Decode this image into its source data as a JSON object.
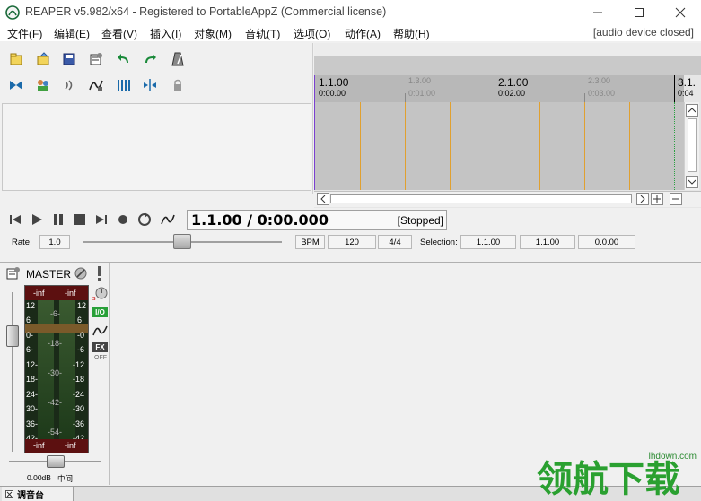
{
  "window": {
    "title": "REAPER v5.982/x64 - Registered to PortableAppZ (Commercial license)"
  },
  "menu": {
    "items": [
      "文件(F)",
      "编辑(E)",
      "查看(V)",
      "插入(I)",
      "对象(M)",
      "音轨(T)",
      "选项(O)",
      "动作(A)",
      "帮助(H)"
    ],
    "status": "[audio device closed]"
  },
  "toolbar": {
    "icons": [
      "new-project-icon",
      "open-project-icon",
      "save-project-icon",
      "project-settings-icon",
      "undo-icon",
      "redo-icon",
      "metronome-icon",
      "ripple-edit-icon",
      "grouping-icon",
      "auto-crossfade-icon",
      "envelope-icon",
      "snap-grid-icon",
      "split-icon",
      "lock-icon"
    ]
  },
  "timeline": {
    "bars": [
      {
        "label": "1.1.00",
        "time": "0:00.00",
        "major": true
      },
      {
        "label": "1.3.00",
        "time": "0:01.00",
        "major": false
      },
      {
        "label": "2.1.00",
        "time": "0:02.00",
        "major": true
      },
      {
        "label": "2.3.00",
        "time": "0:03.00",
        "major": false
      },
      {
        "label": "3.1.",
        "time": "0:04",
        "major": true
      }
    ]
  },
  "transport": {
    "time": "1.1.00 / 0:00.000",
    "status": "[Stopped]",
    "rate_label": "Rate:",
    "rate_value": "1.0",
    "bpm_label": "BPM",
    "bpm_value": "120",
    "time_sig": "4/4",
    "selection_label": "Selection:",
    "sel_start": "1.1.00",
    "sel_end": "1.1.00",
    "sel_length": "0.0.00"
  },
  "mixer": {
    "master_label": "MASTER",
    "meter_top_left": "-inf",
    "meter_top_right": "-inf",
    "meter_bottom_left": "-inf",
    "meter_bottom_right": "-inf",
    "scale": [
      "12",
      "6",
      "0-",
      "6-",
      "12-",
      "18-",
      "24-",
      "30-",
      "36-",
      "42-"
    ],
    "scale_right": [
      "12",
      "6",
      "-0",
      "-6",
      "-12",
      "-18",
      "-24",
      "-30",
      "-36",
      "-42"
    ],
    "mid_scale": [
      "-6-",
      "-18-",
      "-30-",
      "-42-",
      "-54-"
    ],
    "io_label": "I/O",
    "fx_label": "FX",
    "fx_state": "OFF",
    "volume": "0.00dB",
    "pan": "中间",
    "tab_label": "调音台"
  },
  "watermark": {
    "text": "领航下载",
    "site": "lhdown.com"
  }
}
